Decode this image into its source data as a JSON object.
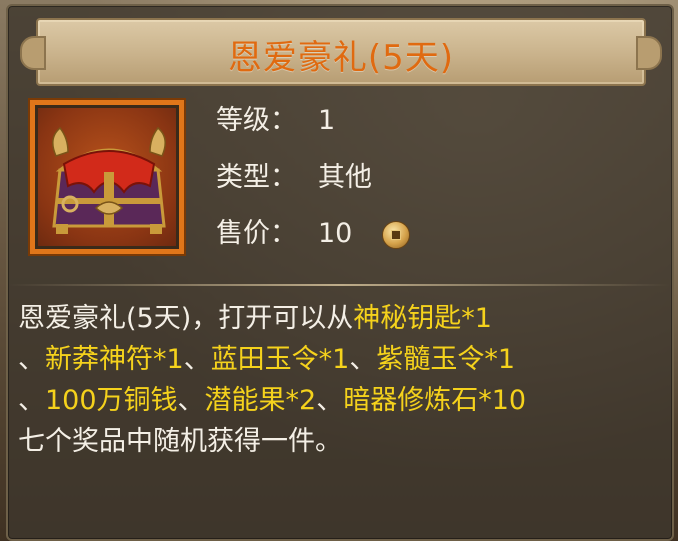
{
  "item": {
    "title": "恩爱豪礼(5天)",
    "icon": "treasure-chest-icon",
    "level_label": "等级：",
    "level_value": "1",
    "type_label": "类型：",
    "type_value": "其他",
    "price_label": "售价：",
    "price_value": "10",
    "currency_icon": "copper-coin-icon"
  },
  "description": {
    "lines": [
      [
        {
          "text": "恩爱豪礼(5天)，打开可以从",
          "color": "white"
        },
        {
          "text": "神秘钥匙*1",
          "color": "yellow"
        }
      ],
      [
        {
          "text": "、",
          "color": "white"
        },
        {
          "text": "新莽神符*1",
          "color": "yellow"
        },
        {
          "text": "、",
          "color": "white"
        },
        {
          "text": "蓝田玉令*1",
          "color": "yellow"
        },
        {
          "text": "、",
          "color": "white"
        },
        {
          "text": "紫髓玉令*1",
          "color": "yellow"
        }
      ],
      [
        {
          "text": "、",
          "color": "white"
        },
        {
          "text": "100万铜钱",
          "color": "yellow"
        },
        {
          "text": "、",
          "color": "white"
        },
        {
          "text": "潜能果*2",
          "color": "yellow"
        },
        {
          "text": "、",
          "color": "white"
        },
        {
          "text": "暗器修炼石*10",
          "color": "yellow"
        }
      ],
      [
        {
          "text": "七个奖品中随机获得一件。",
          "color": "white"
        }
      ]
    ]
  },
  "colors": {
    "title": "#e06a10",
    "highlight": "#f5d21c",
    "text": "#f4efe6",
    "icon_frame": "#e0761a"
  }
}
